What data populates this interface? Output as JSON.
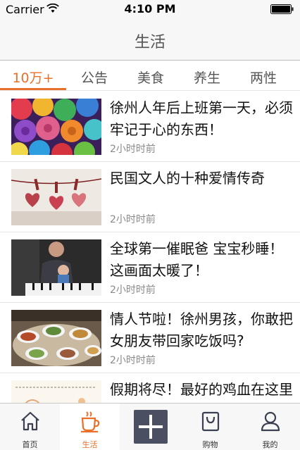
{
  "status_bar": {
    "carrier": "Carrier",
    "time": "4:10 PM",
    "wifi_icon": "wifi-icon",
    "battery_icon": "battery-icon"
  },
  "nav": {
    "title": "生活"
  },
  "tabs": [
    {
      "label": "10万+",
      "active": true
    },
    {
      "label": "公告",
      "active": false
    },
    {
      "label": "美食",
      "active": false
    },
    {
      "label": "养生",
      "active": false
    },
    {
      "label": "两性",
      "active": false
    }
  ],
  "articles": [
    {
      "title": "徐州人年后上班第一天，必须牢记于心的东西！",
      "time": "2小时时前",
      "image": "rainbow-roses"
    },
    {
      "title": "民国文人的十种爱情传奇",
      "time": "2小时时前",
      "image": "hanging-hearts"
    },
    {
      "title": "全球第一催眠爸 宝宝秒睡！这画面太暖了！",
      "time": "2小时时前",
      "image": "dad-piano-baby"
    },
    {
      "title": "情人节啦！徐州男孩，你敢把女朋友带回家吃饭吗?",
      "time": "2小时时前",
      "image": "dinner-table"
    },
    {
      "title": "假期将尽！最好的鸡血在这里",
      "time": "",
      "image": "cartoon-drawing"
    }
  ],
  "tabbar": {
    "items": [
      {
        "label": "首页",
        "icon": "home-icon",
        "active": false
      },
      {
        "label": "生活",
        "icon": "coffee-cup-icon",
        "active": true
      },
      {
        "label": "",
        "icon": "plus-icon",
        "active": false
      },
      {
        "label": "购物",
        "icon": "shopping-bag-icon",
        "active": false
      },
      {
        "label": "我的",
        "icon": "person-icon",
        "active": false
      }
    ]
  },
  "colors": {
    "accent": "#e8702a",
    "plus_button": "#4a4f62"
  }
}
